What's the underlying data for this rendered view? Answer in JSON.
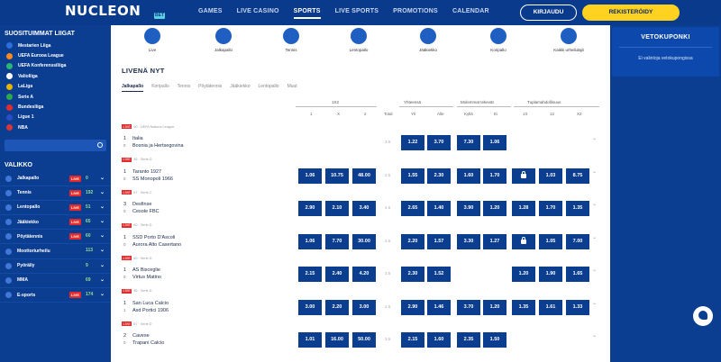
{
  "header": {
    "logo": "NUCLEON",
    "logo_badge": "BET",
    "nav": [
      "GAMES",
      "LIVE CASINO",
      "SPORTS",
      "LIVE SPORTS",
      "PROMOTIONS",
      "CALENDAR"
    ],
    "active_nav": "SPORTS",
    "login_label": "KIRJAUDU",
    "register_label": "REKISTERÖIDY"
  },
  "sidebar": {
    "title": "SUOSITUIMMAT LIIGAT",
    "leagues": [
      {
        "label": "Mestarien Liiga",
        "color": "#2f6fd9"
      },
      {
        "label": "UEFA Eurooa League",
        "color": "#ff8a1f"
      },
      {
        "label": "UEFA Konferenssiliiga",
        "color": "#2bb673"
      },
      {
        "label": "Valioliiga",
        "color": "#ffffff"
      },
      {
        "label": "LaLiga",
        "color": "#e8b400"
      },
      {
        "label": "Serie A",
        "color": "#2faa4a"
      },
      {
        "label": "Bundesliiga",
        "color": "#e02c2c"
      },
      {
        "label": "Ligue 1",
        "color": "#2a4ec9"
      },
      {
        "label": "NBA",
        "color": "#d93636"
      }
    ],
    "menu_title": "VALIKKO",
    "menu": [
      {
        "label": "Jalkapallo",
        "live": "LIVE",
        "count": "0",
        "chev": "⌄"
      },
      {
        "label": "Tennis",
        "live": "LIVE",
        "count": "192",
        "chev": "⌄"
      },
      {
        "label": "Lentopallo",
        "live": "LIVE",
        "count": "51",
        "chev": "⌄"
      },
      {
        "label": "Jääkiekko",
        "live": "LIVE",
        "count": "65",
        "chev": "⌄"
      },
      {
        "label": "Pöytätennis",
        "live": "LIVE",
        "count": "60",
        "chev": "⌄"
      },
      {
        "label": "Moottoriurheilu",
        "live": "",
        "count": "113",
        "chev": "⌄"
      },
      {
        "label": "Pyöräily",
        "live": "",
        "count": "9",
        "chev": "⌄"
      },
      {
        "label": "MMA",
        "live": "",
        "count": "69",
        "chev": "⌄"
      },
      {
        "label": "E-sports",
        "live": "LIVE",
        "count": "174",
        "chev": "⌄"
      }
    ]
  },
  "sports": [
    "Live",
    "Jalkapallo",
    "Tennis",
    "Lentopallo",
    "Jääkiekko",
    "Koripallo",
    "Kaikki urheilulajit"
  ],
  "live_title": "LIVENÄ NYT",
  "subtabs": [
    "Jalkapallo",
    "Koripallo",
    "Tennis",
    "Pöytätennis",
    "Jääkiekko",
    "Lentopallo",
    "Muut"
  ],
  "active_subtab": "Jalkapallo",
  "group_headers": [
    "1X2",
    "Yhteensä",
    "Molemmat tekevät",
    "Tuplamahdollisuus"
  ],
  "col_headers": [
    "1",
    "X",
    "2",
    "Total",
    "Yli",
    "Alle",
    "Kyllä",
    "Ei",
    "1X",
    "12",
    "X2"
  ],
  "matches": [
    {
      "live": "LIVE",
      "meta": "90 · UEFA Nations League",
      "time": "1",
      "num": "0",
      "home": "Italia",
      "away": "Bosnia ja Hertsegovina",
      "odds": [
        "",
        "",
        ""
      ],
      "hcap": "3.5",
      "yli": "1.22",
      "alle": "3.70",
      "kylla": "7.30",
      "ei": "1.06",
      "dc": [
        "",
        "",
        ""
      ],
      "lock": false
    },
    {
      "live": "LIVE",
      "meta": "45 · Serie D",
      "time": "1",
      "num": "0",
      "home": "Taranto 1927",
      "away": "SS Monopoli 1966",
      "odds": [
        "1.06",
        "10.75",
        "48.00"
      ],
      "hcap": "2.5",
      "yli": "1.55",
      "alle": "2.30",
      "kylla": "1.60",
      "ei": "1.70",
      "dc": [
        "",
        "1.03",
        "8.75"
      ],
      "lock": true
    },
    {
      "live": "LIVE",
      "meta": "67 · Serie C",
      "time": "3",
      "num": "0",
      "home": "Desfinse",
      "away": "Cesole FBC",
      "odds": [
        "2.90",
        "2.10",
        "3.40"
      ],
      "hcap": "4.5",
      "yli": "2.65",
      "alle": "1.40",
      "kylla": "3.90",
      "ei": "1.20",
      "dc": [
        "1.28",
        "1.70",
        "1.35"
      ],
      "lock": false
    },
    {
      "live": "LIVE",
      "meta": "60 · Serie D",
      "time": "1",
      "num": "0",
      "home": "SSD Porto D'Ascoli",
      "away": "Aurora Alto Casertano",
      "odds": [
        "1.06",
        "7.70",
        "30.00"
      ],
      "hcap": "2.5",
      "yli": "2.20",
      "alle": "1.57",
      "kylla": "3.30",
      "ei": "1.27",
      "dc": [
        "",
        "1.05",
        "7.00"
      ],
      "lock": true
    },
    {
      "live": "LIVE",
      "meta": "60 · Serie D",
      "time": "1",
      "num": "0",
      "home": "AS Bisceglie",
      "away": "Virtus Matino",
      "odds": [
        "2.15",
        "2.40",
        "4.20"
      ],
      "hcap": "3.5",
      "yli": "2.30",
      "alle": "1.52",
      "kylla": "",
      "ei": "",
      "dc": [
        "1.20",
        "1.90",
        "1.65"
      ],
      "lock": false
    },
    {
      "live": "LIVE",
      "meta": "45 · Serie D",
      "time": "1",
      "num": "1",
      "home": "San Luca Calcio",
      "away": "Asd Portici 1906",
      "odds": [
        "3.00",
        "2.20",
        "3.00"
      ],
      "hcap": "2.5",
      "yli": "2.90",
      "alle": "1.46",
      "kylla": "3.70",
      "ei": "1.20",
      "dc": [
        "1.35",
        "1.61",
        "1.33"
      ],
      "lock": false
    },
    {
      "live": "LIVE",
      "meta": "67 · Serie D",
      "time": "2",
      "num": "0",
      "home": "Cavese",
      "away": "Trapani Calcio",
      "odds": [
        "1.01",
        "16.00",
        "50.00"
      ],
      "hcap": "3.5",
      "yli": "2.15",
      "alle": "1.60",
      "kylla": "2.35",
      "ei": "1.50",
      "dc": [
        "",
        "",
        ""
      ],
      "lock": false
    }
  ],
  "coupon": {
    "title": "VETOKUPONKI",
    "empty": "Ei valintoja vetokupongissa"
  }
}
